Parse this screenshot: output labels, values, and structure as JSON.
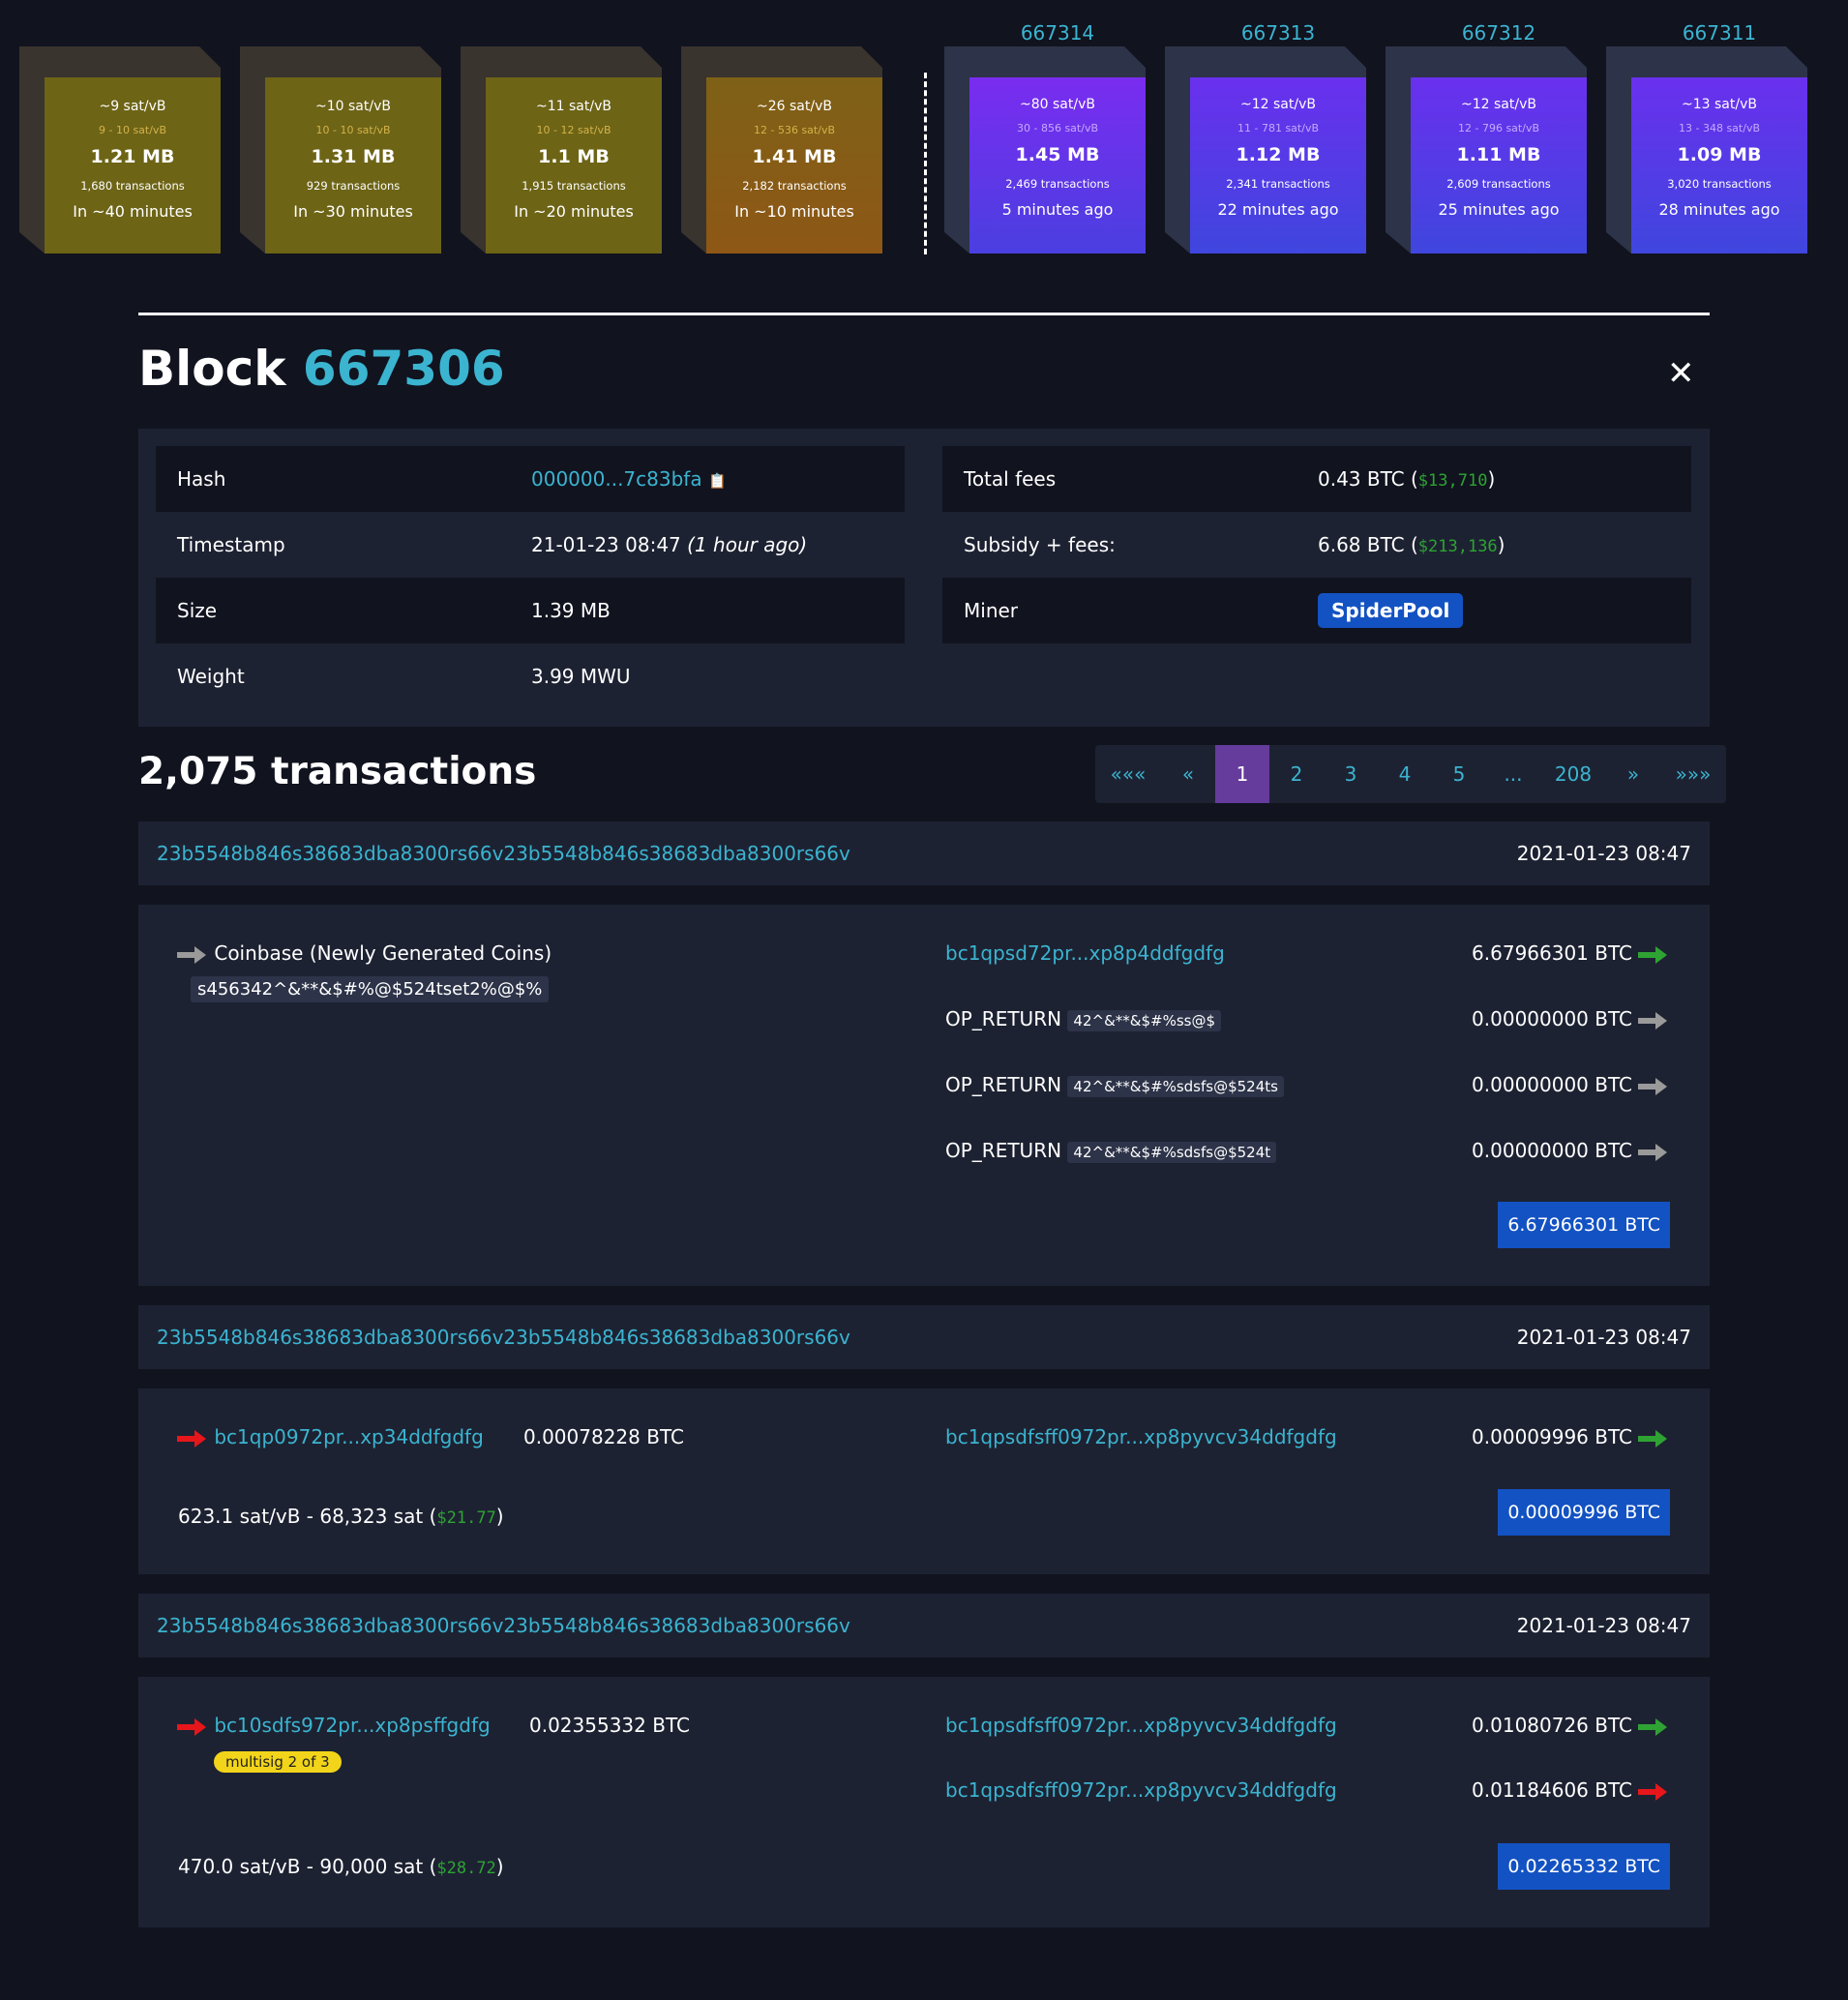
{
  "colors": {
    "background": "#11131f",
    "panel": "#1d2232",
    "accent_link": "#3bb4d0",
    "mined_purple": "#7a2cf0",
    "mined_blue": "#3f46de",
    "mempool_olive": "#6d6416",
    "mempool_orange": "#8e5716",
    "miner_badge": "#1352c2",
    "page_active": "#653b9c",
    "green": "#2ea333",
    "red": "#e6161a",
    "multisig": "#f2d51a"
  },
  "mempool_blocks": [
    {
      "fee": "~9 sat/vB",
      "range": "9 - 10 sat/vB",
      "size": "1.21 MB",
      "txs": "1,680 transactions",
      "time": "In ~40 minutes"
    },
    {
      "fee": "~10 sat/vB",
      "range": "10 - 10 sat/vB",
      "size": "1.31 MB",
      "txs": "929 transactions",
      "time": "In ~30 minutes"
    },
    {
      "fee": "~11 sat/vB",
      "range": "10 - 12 sat/vB",
      "size": "1.1 MB",
      "txs": "1,915 transactions",
      "time": "In ~20 minutes"
    },
    {
      "fee": "~26 sat/vB",
      "range": "12 - 536 sat/vB",
      "size": "1.41 MB",
      "txs": "2,182 transactions",
      "time": "In ~10 minutes"
    }
  ],
  "mined_blocks": [
    {
      "height": "667314",
      "fee": "~80 sat/vB",
      "range": "30 - 856 sat/vB",
      "size": "1.45 MB",
      "txs": "2,469 transactions",
      "time": "5 minutes ago"
    },
    {
      "height": "667313",
      "fee": "~12 sat/vB",
      "range": "11 - 781 sat/vB",
      "size": "1.12 MB",
      "txs": "2,341 transactions",
      "time": "22 minutes ago"
    },
    {
      "height": "667312",
      "fee": "~12 sat/vB",
      "range": "12 - 796 sat/vB",
      "size": "1.11 MB",
      "txs": "2,609 transactions",
      "time": "25 minutes ago"
    },
    {
      "height": "667311",
      "fee": "~13 sat/vB",
      "range": "13 - 348 sat/vB",
      "size": "1.09 MB",
      "txs": "3,020 transactions",
      "time": "28 minutes ago"
    }
  ],
  "block": {
    "title_word": "Block",
    "height": "667306",
    "close_icon": "✕",
    "left": [
      {
        "key": "Hash",
        "value": "000000...7c83bfa",
        "copy_icon": "📋"
      },
      {
        "key": "Timestamp",
        "value": "21-01-23 08:47",
        "relative": "(1 hour ago)"
      },
      {
        "key": "Size",
        "value": "1.39 MB"
      },
      {
        "key": "Weight",
        "value": "3.99 MWU"
      }
    ],
    "right": [
      {
        "key": "Total fees",
        "value_btc": "0.43 BTC (",
        "value_usd": "$13,710",
        "close": ")"
      },
      {
        "key": "Subsidy + fees:",
        "value_btc": "6.68 BTC (",
        "value_usd": "$213,136",
        "close": ")"
      },
      {
        "key": "Miner",
        "miner": "SpiderPool"
      }
    ]
  },
  "transactions_header": {
    "count_label": "2,075 transactions"
  },
  "pagination": {
    "first": "«««",
    "prev": "«",
    "pages": [
      "1",
      "2",
      "3",
      "4",
      "5",
      "...",
      "208"
    ],
    "next": "»",
    "last": "»»»",
    "active": "1"
  },
  "tx1": {
    "txid": "23b5548b846s38683dba8300rs66v23b5548b846s38683dba8300rs66v",
    "time": "2021-01-23 08:47",
    "input_label": "Coinbase (Newly Generated Coins)",
    "coinbase_script": "s456342^&**&$#%@$524tset2%@$%",
    "outputs": [
      {
        "address": "bc1qpsd72pr...xp8p4ddfgdfg",
        "amount": "6.67966301 BTC"
      },
      {
        "address": "OP_RETURN",
        "script": "42^&**&$#%ss@$",
        "amount": "0.00000000 BTC"
      },
      {
        "address": "OP_RETURN",
        "script": "42^&**&$#%sdsfs@$524ts",
        "amount": "0.00000000 BTC"
      },
      {
        "address": "OP_RETURN",
        "script": "42^&**&$#%sdsfs@$524t",
        "amount": "0.00000000 BTC"
      }
    ],
    "total": "6.67966301 BTC"
  },
  "tx2": {
    "txid": "23b5548b846s38683dba8300rs66v23b5548b846s38683dba8300rs66v",
    "time": "2021-01-23 08:47",
    "input_address": "bc1qp0972pr...xp34ddfgdfg",
    "input_amount": "0.00078228 BTC",
    "output_address": "bc1qpsdfsff0972pr...xp8pyvcv34ddfgdfg",
    "output_amount": "0.00009996 BTC",
    "fee_text": "623.1 sat/vB - 68,323 sat (",
    "fee_usd": "$21.77",
    "fee_close": ")",
    "total": "0.00009996 BTC"
  },
  "tx3": {
    "txid": "23b5548b846s38683dba8300rs66v23b5548b846s38683dba8300rs66v",
    "time": "2021-01-23 08:47",
    "input_address": "bc10sdfs972pr...xp8psffgdfg",
    "input_amount": "0.02355332 BTC",
    "multisig": "multisig 2 of 3",
    "outputs": [
      {
        "address": "bc1qpsdfsff0972pr...xp8pyvcv34ddfgdfg",
        "amount": "0.01080726 BTC"
      },
      {
        "address": "bc1qpsdfsff0972pr...xp8pyvcv34ddfgdfg",
        "amount": "0.01184606 BTC"
      }
    ],
    "fee_text": "470.0 sat/vB - 90,000 sat (",
    "fee_usd": "$28.72",
    "fee_close": ")",
    "total": "0.02265332 BTC"
  }
}
